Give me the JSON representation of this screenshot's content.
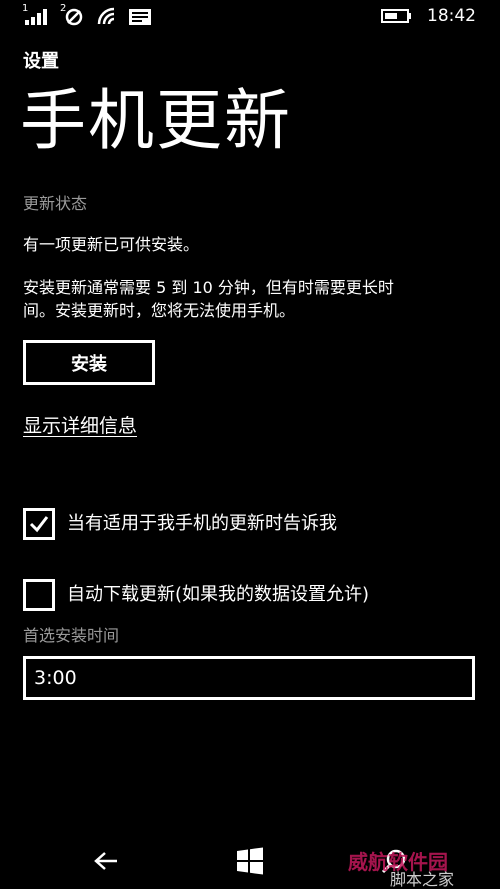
{
  "status_bar": {
    "signal1_label": "1",
    "signal2_label": "2",
    "time": "18:42"
  },
  "app": {
    "title": "设置"
  },
  "page": {
    "title": "手机更新"
  },
  "update_status": {
    "section_label": "更新状态",
    "message": "有一项更新已可供安装。",
    "description_line1": "安装更新通常需要 5 到 10 分钟，但有时需要更长时",
    "description_line2": "间。安装更新时，您将无法使用手机。",
    "install_label": "安装",
    "details_link": "显示详细信息"
  },
  "options": {
    "notify": {
      "label": "当有适用于我手机的更新时告诉我",
      "checked": true
    },
    "auto_download": {
      "label": "自动下载更新(如果我的数据设置允许)",
      "checked": false
    }
  },
  "install_time": {
    "label": "首选安装时间",
    "value": "3:00"
  },
  "colors": {
    "background": "#000000",
    "foreground": "#ffffff",
    "secondary_text": "#9a9a9a"
  },
  "nav": {
    "icons": [
      "back-arrow-icon",
      "windows-logo-icon",
      "search-icon"
    ]
  }
}
